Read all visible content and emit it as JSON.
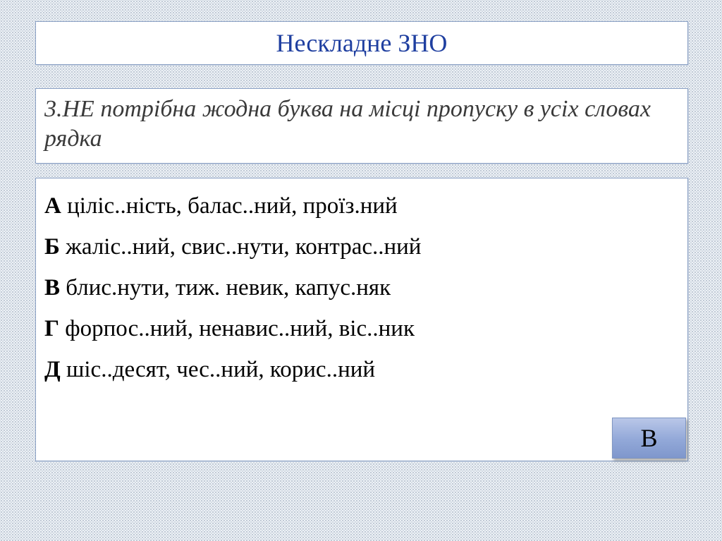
{
  "header": {
    "title": "Нескладне ЗНО"
  },
  "question": {
    "text": "3.НЕ потрібна жодна буква на місці пропуску в усіх словах рядка"
  },
  "answers": [
    {
      "letter": "А",
      "text": "ціліс..ність, балас..ний, проїз.ний"
    },
    {
      "letter": "Б",
      "text": "жаліс..ний, свис..нути, контрас..ний"
    },
    {
      "letter": "В",
      "text": "блис.нути, тиж. невик, капус.няк"
    },
    {
      "letter": "Г",
      "text": "форпос..ний, ненавис..ний, віс..ник"
    },
    {
      "letter": "Д",
      "text": "шіс..десят, чес..ний, корис..ний"
    }
  ],
  "answer_button": {
    "label": "В"
  },
  "colors": {
    "title": "#1f3fa0",
    "border": "#8aa0c4",
    "button": "#92a8d8"
  }
}
